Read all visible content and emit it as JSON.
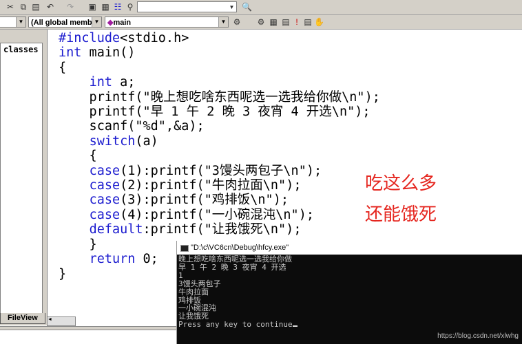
{
  "toolbar": {
    "find_value": "",
    "class_combo": "",
    "members_combo": "(All global members",
    "function_combo": "main",
    "icons": [
      "cut-icon",
      "copy-icon",
      "paste-icon",
      "undo-icon",
      "redo-icon",
      "workspace-icon",
      "output-icon",
      "window-list-icon",
      "find-in-files-icon",
      "find-icon"
    ]
  },
  "workspace": {
    "tab_label": "classes",
    "fileview_tab": "FileView"
  },
  "code": {
    "lines": [
      [
        [
          "kw",
          "#include"
        ],
        [
          "",
          "<stdio.h>"
        ]
      ],
      [
        [
          "kw",
          "int"
        ],
        [
          "",
          " main()"
        ]
      ],
      [
        [
          "",
          "{"
        ]
      ],
      [
        [
          "",
          "    "
        ],
        [
          "kw",
          "int"
        ],
        [
          "",
          " a;"
        ]
      ],
      [
        [
          "",
          "    printf(\"晚上想吃啥东西呢选一选我给你做\\n\");"
        ]
      ],
      [
        [
          "",
          "    printf(\"早 1 午 2 晚 3 夜宵 4 开选\\n\");"
        ]
      ],
      [
        [
          "",
          "    scanf(\"%d\",&a);"
        ]
      ],
      [
        [
          "",
          "    "
        ],
        [
          "kw",
          "switch"
        ],
        [
          "",
          "(a)"
        ]
      ],
      [
        [
          "",
          "    {"
        ]
      ],
      [
        [
          "",
          "    "
        ],
        [
          "kw",
          "case"
        ],
        [
          "",
          "(1):printf(\"3馒头两包子\\n\");"
        ]
      ],
      [
        [
          "",
          "    "
        ],
        [
          "kw",
          "case"
        ],
        [
          "",
          "(2):printf(\"牛肉拉面\\n\");"
        ]
      ],
      [
        [
          "",
          "    "
        ],
        [
          "kw",
          "case"
        ],
        [
          "",
          "(3):printf(\"鸡排饭\\n\");"
        ]
      ],
      [
        [
          "",
          "    "
        ],
        [
          "kw",
          "case"
        ],
        [
          "",
          "(4):printf(\"一小碗混沌\\n\");"
        ]
      ],
      [
        [
          "",
          "    "
        ],
        [
          "kw",
          "default"
        ],
        [
          "",
          ":printf(\"让我饿死\\n\");"
        ]
      ],
      [
        [
          "",
          "    }"
        ]
      ],
      [
        [
          "",
          "    "
        ],
        [
          "kw",
          "return"
        ],
        [
          "",
          " 0;"
        ]
      ],
      [
        [
          "",
          "}"
        ]
      ]
    ]
  },
  "annotation": {
    "line1": "吃这么多",
    "line2": "还能饿死",
    "color": "#e5261f"
  },
  "console": {
    "title": "\"D:\\c\\VC6cn\\Debug\\hfcy.exe\"",
    "output": "晚上想吃啥东西呢选一选我给你做\n早 1 午 2 晚 3 夜宵 4 开选\n1\n3馒头两包子\n牛肉拉面\n鸡排饭\n一小碗混沌\n让我饿死\nPress any key to continue",
    "watermark": "https://blog.csdn.net/xlwhg"
  }
}
